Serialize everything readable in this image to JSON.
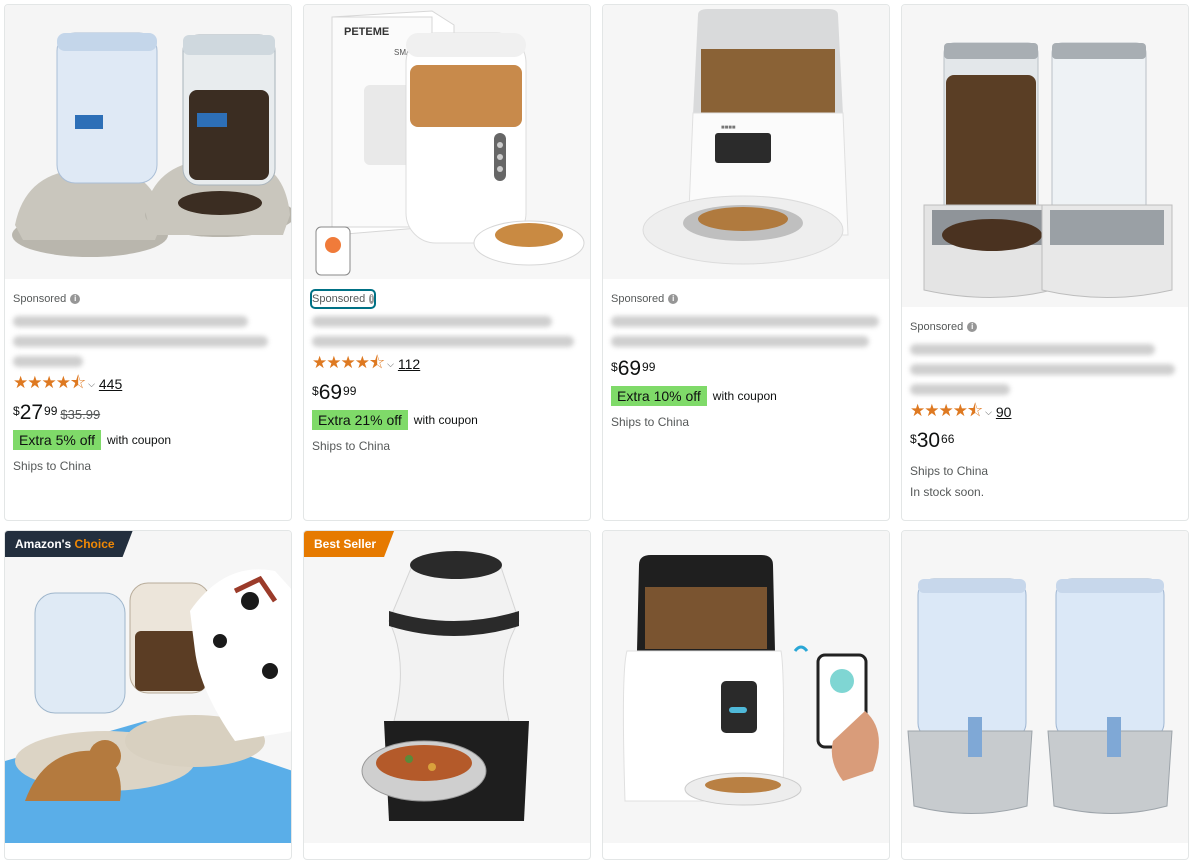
{
  "products": [
    {
      "sponsored": "Sponsored",
      "rating": {
        "stars": "★★★★⯪",
        "count": "445"
      },
      "price": {
        "currency": "$",
        "whole": "27",
        "fraction": "99",
        "was": "$35.99"
      },
      "coupon": {
        "badge": "Extra 5% off",
        "text": "with coupon"
      },
      "ships": "Ships to China"
    },
    {
      "sponsored": "Sponsored",
      "rating": {
        "stars": "★★★★⯪",
        "count": "112"
      },
      "price": {
        "currency": "$",
        "whole": "69",
        "fraction": "99"
      },
      "coupon": {
        "badge": "Extra 21% off",
        "text": "with coupon"
      },
      "ships": "Ships to China",
      "image_brand": "PETEME",
      "image_brand_small": "SMAR"
    },
    {
      "sponsored": "Sponsored",
      "price": {
        "currency": "$",
        "whole": "69",
        "fraction": "99"
      },
      "coupon": {
        "badge": "Extra 10% off",
        "text": "with coupon"
      },
      "ships": "Ships to China"
    },
    {
      "sponsored": "Sponsored",
      "rating": {
        "stars": "★★★★⯪",
        "count": "90"
      },
      "price": {
        "currency": "$",
        "whole": "30",
        "fraction": "66"
      },
      "ships": "Ships to China",
      "stock": "In stock soon."
    }
  ],
  "row2": {
    "amazons_choice": {
      "prefix": "Amazon's",
      "highlight": "Choice"
    },
    "best_seller": "Best Seller"
  },
  "colors": {
    "star": "#de7921",
    "coupon_green": "#7fda69",
    "link_teal": "#007185"
  }
}
